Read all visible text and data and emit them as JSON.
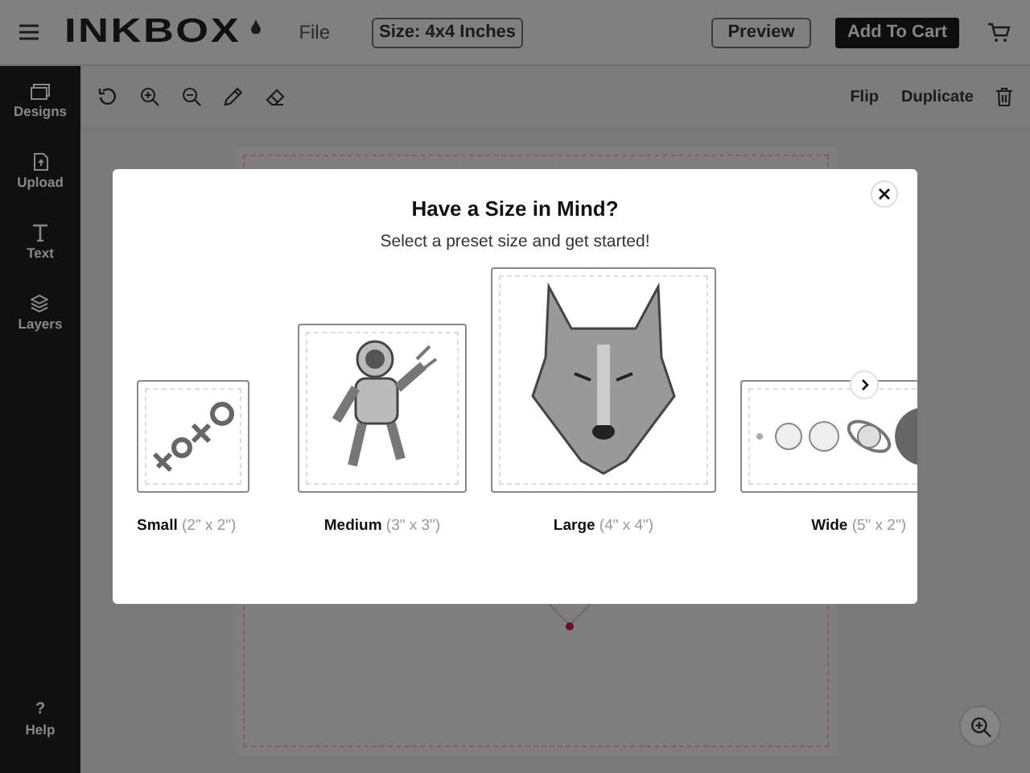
{
  "header": {
    "logo": "INKBOX",
    "file_menu": "File",
    "size_button": "Size: 4x4 Inches",
    "preview_button": "Preview",
    "cart_button": "Add To Cart"
  },
  "sidebar": {
    "items": [
      {
        "label": "Designs",
        "kind": "designs"
      },
      {
        "label": "Upload",
        "kind": "upload"
      },
      {
        "label": "Text",
        "kind": "text"
      },
      {
        "label": "Layers",
        "kind": "layers"
      }
    ],
    "help_icon": "?",
    "help": "Help"
  },
  "toolbar": {
    "actions": [
      "Flip",
      "Duplicate"
    ]
  },
  "dialog": {
    "title": "Have a Size in Mind?",
    "subtitle": "Select a preset size and get started!",
    "presets": [
      {
        "label": "**Small** (2\" x 2\")",
        "kind": "small"
      },
      {
        "label": "**Medium** (3\" x 3\")",
        "kind": "medium"
      },
      {
        "label": "**Large** (4\" x 4\")",
        "kind": "large"
      },
      {
        "label": "**Wide** (5\" x 2\")",
        "kind": "wide"
      }
    ]
  }
}
